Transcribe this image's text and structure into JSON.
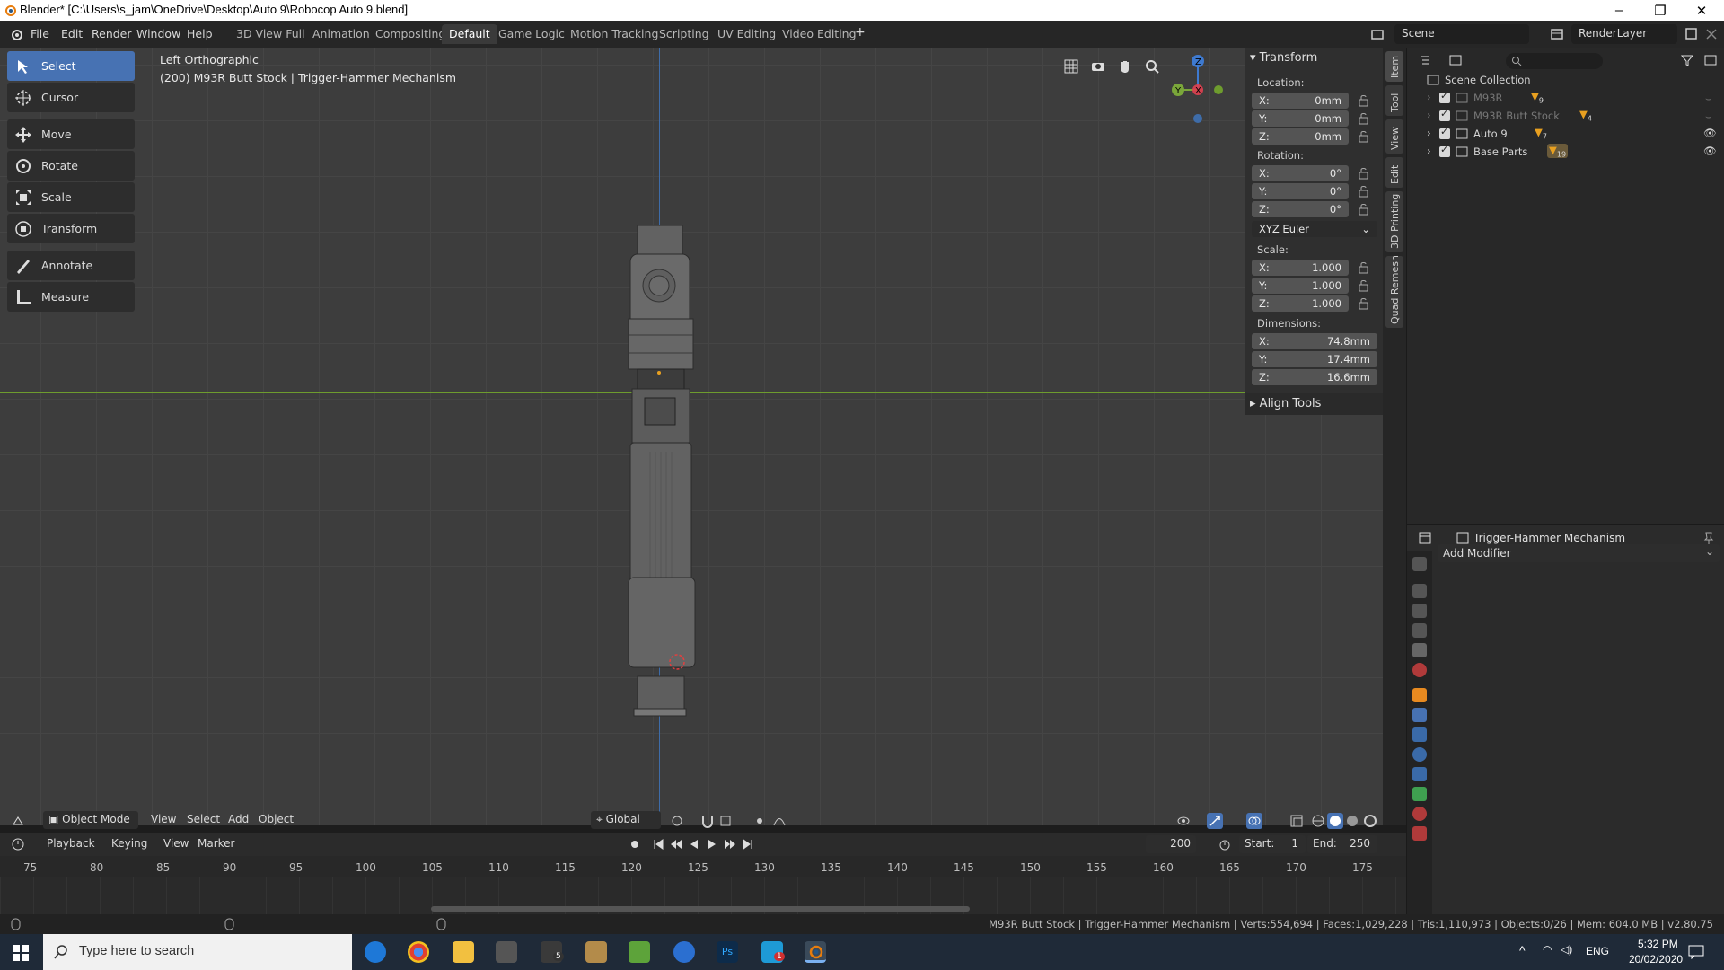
{
  "window": {
    "title": "Blender* [C:\\Users\\s_jam\\OneDrive\\Desktop\\Auto 9\\Robocop Auto 9.blend]",
    "minimize": "–",
    "maximize": "❐",
    "close": "✕"
  },
  "menu": [
    "File",
    "Edit",
    "Render",
    "Window",
    "Help"
  ],
  "workspaces": [
    "3D View Full",
    "Animation",
    "Compositing",
    "Default",
    "Game Logic",
    "Motion Tracking",
    "Scripting",
    "UV Editing",
    "Video Editing"
  ],
  "active_workspace": "Default",
  "add_workspace": "+",
  "scene": {
    "name": "Scene",
    "view_layer": "RenderLayer"
  },
  "viewport": {
    "view_name": "Left Orthographic",
    "object_info": "(200) M93R Butt Stock | Trigger-Hammer Mechanism",
    "gizmo": {
      "z": "Z",
      "y": "Y",
      "x": "X"
    }
  },
  "tools": [
    {
      "label": "Select",
      "icon": "select-box-icon",
      "active": true
    },
    {
      "label": "Cursor",
      "icon": "cursor-icon"
    },
    {
      "label": "Move",
      "icon": "move-icon"
    },
    {
      "label": "Rotate",
      "icon": "rotate-icon"
    },
    {
      "label": "Scale",
      "icon": "scale-icon"
    },
    {
      "label": "Transform",
      "icon": "transform-icon"
    },
    {
      "label": "Annotate",
      "icon": "annotate-icon"
    },
    {
      "label": "Measure",
      "icon": "measure-icon"
    }
  ],
  "npanel": {
    "header": "Transform",
    "location_label": "Location:",
    "location": {
      "x": "0mm",
      "y": "0mm",
      "z": "0mm"
    },
    "rotation_label": "Rotation:",
    "rotation": {
      "x": "0°",
      "y": "0°",
      "z": "0°"
    },
    "rotation_mode": "XYZ Euler",
    "scale_label": "Scale:",
    "scale": {
      "x": "1.000",
      "y": "1.000",
      "z": "1.000"
    },
    "dimensions_label": "Dimensions:",
    "dimensions": {
      "x": "74.8mm",
      "y": "17.4mm",
      "z": "16.6mm"
    },
    "axis": {
      "x": "X:",
      "y": "Y:",
      "z": "Z:"
    },
    "align_tools": "Align Tools",
    "tabs": [
      "Item",
      "Tool",
      "View",
      "Edit",
      "3D Printing",
      "Quad Remesh"
    ]
  },
  "vp_header": {
    "mode": "Object Mode",
    "menus": [
      "View",
      "Select",
      "Add",
      "Object"
    ],
    "orientation": "Global"
  },
  "timeline": {
    "menus": [
      "Playback",
      "Keying",
      "View",
      "Marker"
    ],
    "current_frame": "200",
    "start_label": "Start:",
    "start": "1",
    "end_label": "End:",
    "end": "250",
    "ticks": [
      "75",
      "80",
      "85",
      "90",
      "95",
      "100",
      "105",
      "110",
      "115",
      "120",
      "125",
      "130",
      "135",
      "140",
      "145",
      "150",
      "155",
      "160",
      "165",
      "170",
      "175"
    ]
  },
  "status": "M93R Butt Stock | Trigger-Hammer Mechanism | Verts:554,694 | Faces:1,029,228 | Tris:1,110,973 | Objects:0/26 | Mem: 604.0 MB | v2.80.75",
  "outliner": {
    "root": "Scene Collection",
    "items": [
      {
        "name": "M93R",
        "badge": "9",
        "dim": true
      },
      {
        "name": "M93R Butt Stock",
        "badge": "4",
        "dim": true
      },
      {
        "name": "Auto 9",
        "badge": "7",
        "dim": false
      },
      {
        "name": "Base Parts",
        "badge": "19",
        "dim": false
      }
    ]
  },
  "properties": {
    "object_name": "Trigger-Hammer Mechanism",
    "add_modifier": "Add Modifier"
  },
  "taskbar": {
    "search_placeholder": "Type here to search",
    "mail_badge": "5",
    "app_badge": "1",
    "lang": "ENG",
    "time": "5:32 PM",
    "date": "20/02/2020"
  },
  "colors": {
    "accent": "#4772b3",
    "x_axis": "#6e9c2e",
    "z_axis": "#3e6ca8"
  }
}
